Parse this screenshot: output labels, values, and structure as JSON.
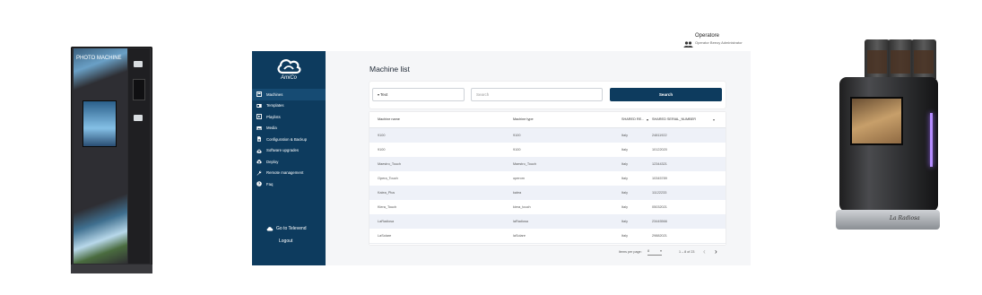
{
  "vending_machine": {
    "logo_text": "PHOTO MACHINE"
  },
  "coffee_machine": {
    "brand_plate": "La Radiosa"
  },
  "operator": {
    "name": "Operatore",
    "role": "Operator Beeoy Administrator",
    "icon": "users-icon"
  },
  "app": {
    "logo_name": "AmiCo",
    "nav": [
      {
        "label": "Machines",
        "icon": "machines-icon",
        "active": true
      },
      {
        "label": "Templates",
        "icon": "templates-icon",
        "active": false
      },
      {
        "label": "Playlists",
        "icon": "playlists-icon",
        "active": false
      },
      {
        "label": "Media",
        "icon": "media-icon",
        "active": false
      },
      {
        "label": "Configuration & Backup",
        "icon": "configuration-icon",
        "active": false
      },
      {
        "label": "Software upgrades",
        "icon": "software-icon",
        "active": false
      },
      {
        "label": "Deploy",
        "icon": "deploy-icon",
        "active": false
      },
      {
        "label": "Remote management",
        "icon": "wrench-icon",
        "active": false
      },
      {
        "label": "Faq",
        "icon": "help-icon",
        "active": false
      }
    ],
    "goto_label": "Go to Televend",
    "logout_label": "Logout"
  },
  "main": {
    "title": "Machine list",
    "search": {
      "field_value": "Text",
      "input_placeholder": "Search",
      "button_label": "Search"
    },
    "table": {
      "columns": [
        "Machine name",
        "Machine type",
        "SHARED RE...",
        "SHARED SERIAL_NUMBER"
      ],
      "rows": [
        [
          "9100",
          "9100",
          "Italy",
          "24811922"
        ],
        [
          "9100",
          "9100",
          "Italy",
          "10122020"
        ],
        [
          "Maestro_Touch",
          "Maestro_Touch",
          "Italy",
          "12344321"
        ],
        [
          "Opera_Touch",
          "operom",
          "Italy",
          "10345789"
        ],
        [
          "Kalea_Plus",
          "kalea",
          "Italy",
          "11122233"
        ],
        [
          "Kiera_Touch",
          "kiera_touch",
          "Italy",
          "05032021"
        ],
        [
          "LaRadiosa",
          "laRadiosa",
          "Italy",
          "23445566"
        ],
        [
          "LaSolare",
          "laSolare",
          "Italy",
          "29882021"
        ]
      ]
    },
    "pagination": {
      "items_per_page_label": "Items per page:",
      "items_per_page": "8",
      "range": "1 – 8 of 23"
    }
  }
}
